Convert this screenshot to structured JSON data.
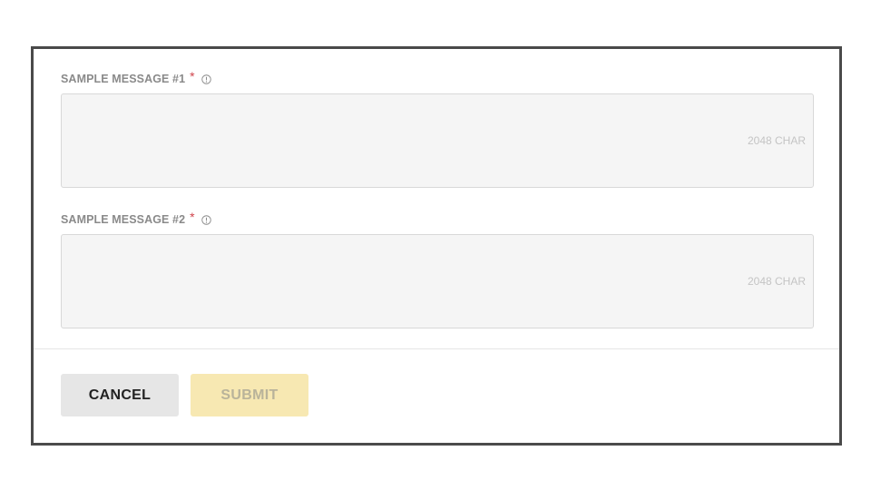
{
  "form": {
    "fields": [
      {
        "label": "SAMPLE MESSAGE #1",
        "required_mark": "*",
        "info_icon": "info-circle-icon",
        "value": "",
        "char_limit": "2048 CHAR"
      },
      {
        "label": "SAMPLE MESSAGE #2",
        "required_mark": "*",
        "info_icon": "info-circle-icon",
        "value": "",
        "char_limit": "2048 CHAR"
      }
    ],
    "actions": {
      "cancel_label": "CANCEL",
      "submit_label": "SUBMIT",
      "submit_disabled": true
    }
  },
  "colors": {
    "frame_border": "#4a4a4a",
    "label": "#8a8a8a",
    "required": "#d0454c",
    "input_bg": "#f5f5f5",
    "cancel_bg": "#e6e6e6",
    "submit_bg_disabled": "#f7e8b2"
  }
}
